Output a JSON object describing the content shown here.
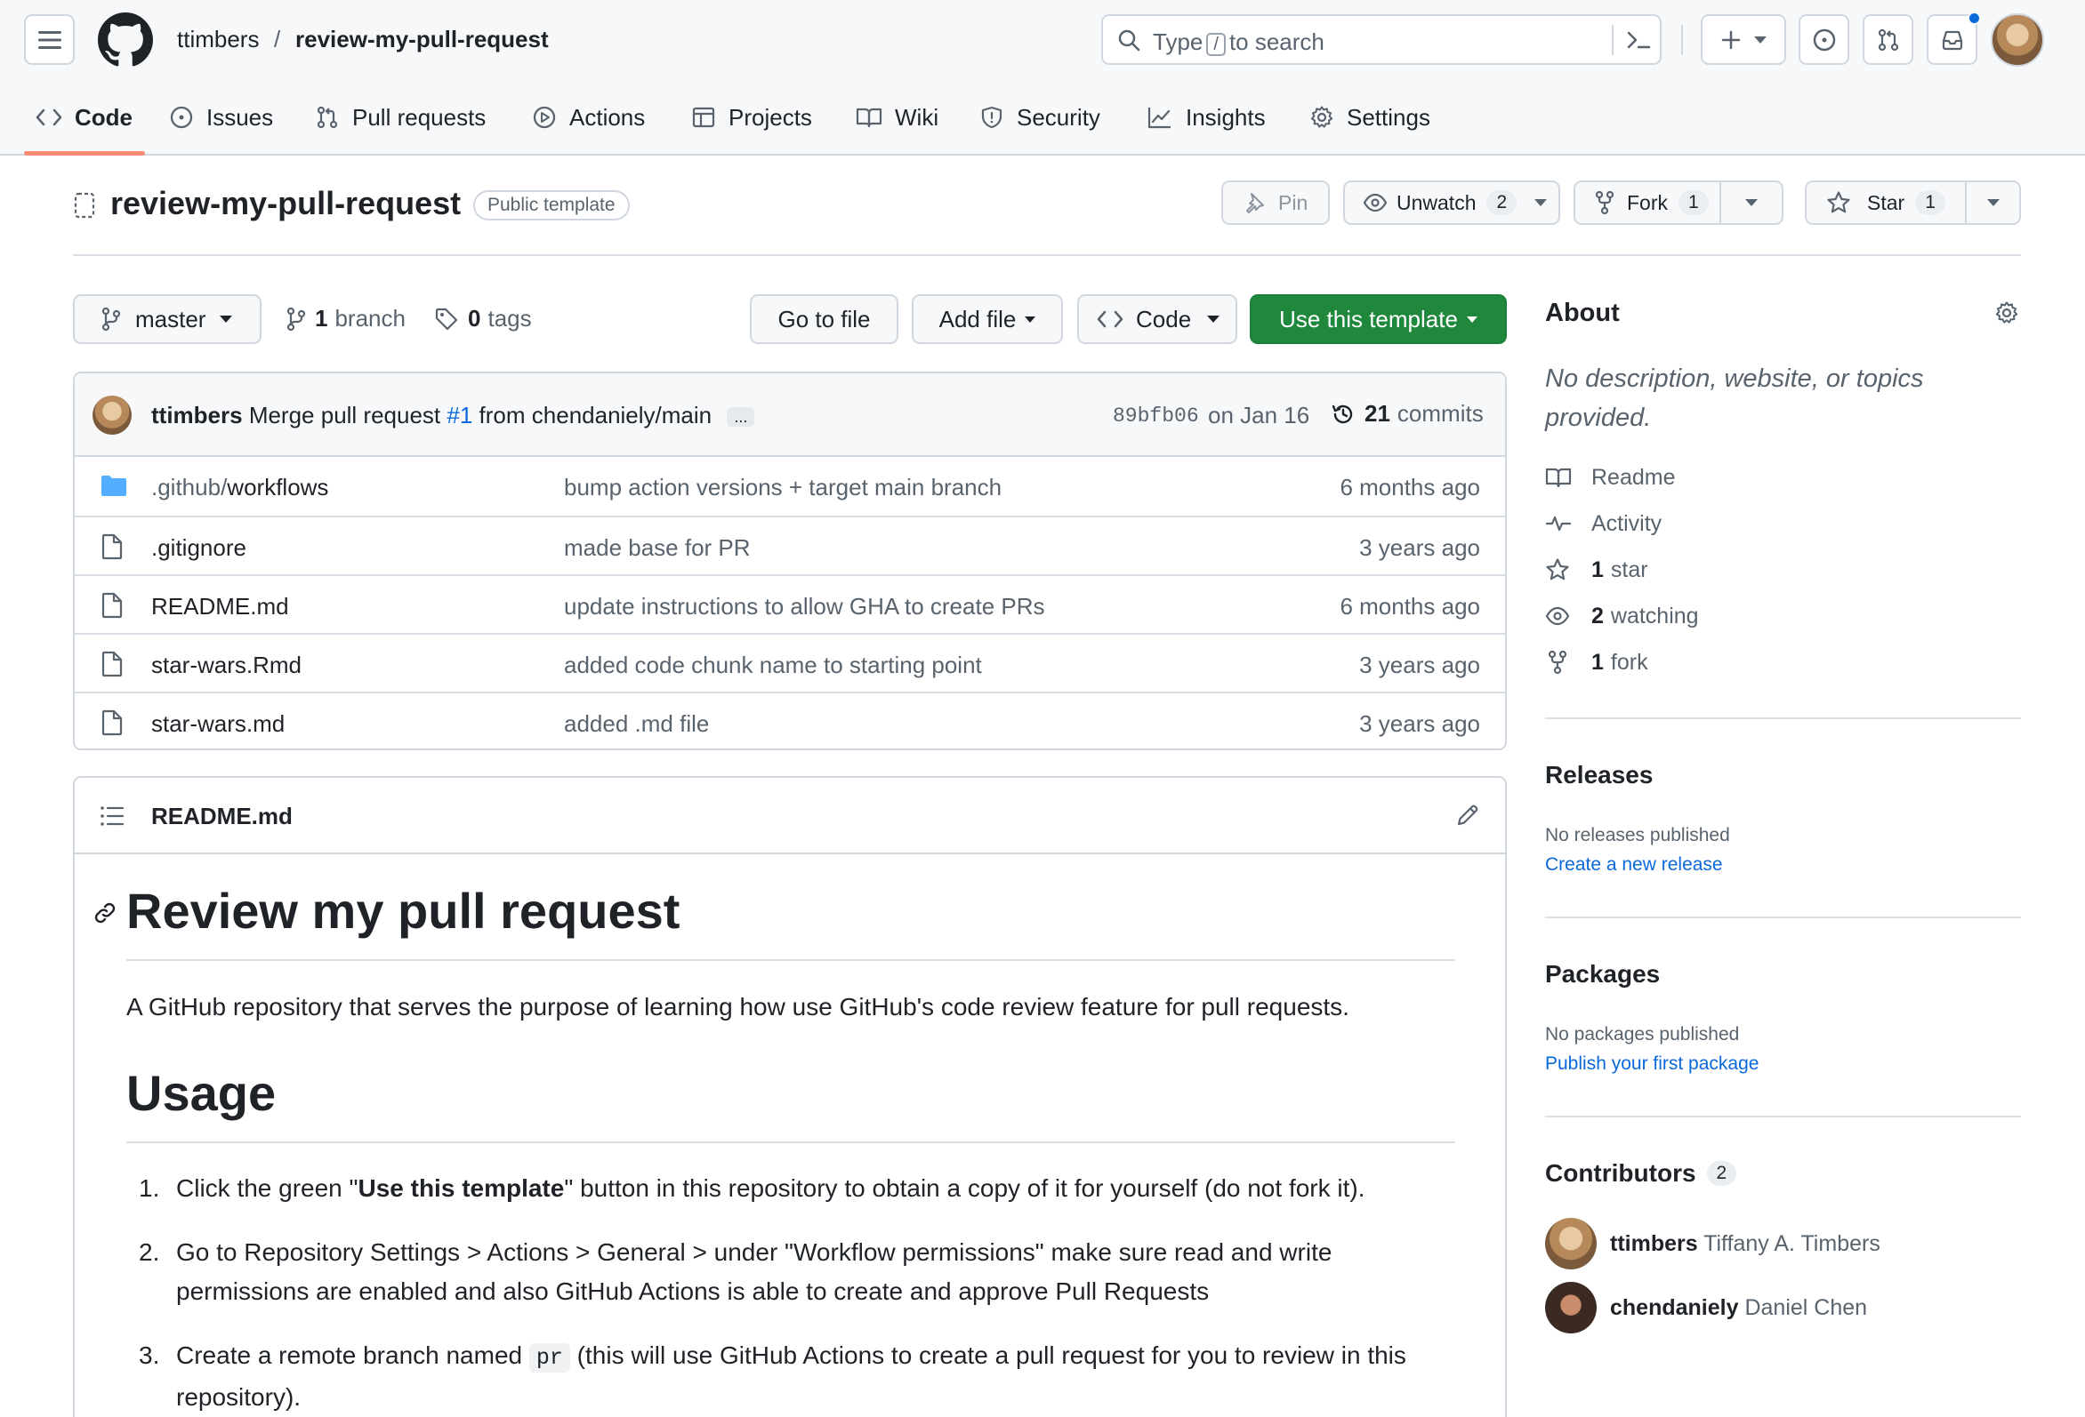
{
  "header": {
    "owner": "ttimbers",
    "separator": "/",
    "repo": "review-my-pull-request",
    "search_before": "Type",
    "search_key": "/",
    "search_after": "to search"
  },
  "nav": {
    "code": "Code",
    "issues": "Issues",
    "pull_requests": "Pull requests",
    "actions": "Actions",
    "projects": "Projects",
    "wiki": "Wiki",
    "security": "Security",
    "insights": "Insights",
    "settings": "Settings"
  },
  "repo": {
    "name": "review-my-pull-request",
    "visibility": "Public template",
    "pin": "Pin",
    "unwatch": "Unwatch",
    "watch_count": "2",
    "fork": "Fork",
    "fork_count": "1",
    "star": "Star",
    "star_count": "1"
  },
  "branchbar": {
    "branch": "master",
    "branches_count": "1",
    "branches_label": "branch",
    "tags_count": "0",
    "tags_label": "tags",
    "go_to_file": "Go to file",
    "add_file": "Add file",
    "code": "Code",
    "use_template": "Use this template"
  },
  "commit": {
    "author": "ttimbers",
    "message_before": "Merge pull request",
    "pr_link": "#1",
    "message_after": "from chendaniely/main",
    "more": "...",
    "sha": "89bfb06",
    "date": "on Jan 16",
    "commits_count": "21",
    "commits_label": "commits"
  },
  "files": [
    {
      "name_prefix": ".github/",
      "name": "workflows",
      "message": "bump action versions + target main branch",
      "age": "6 months ago",
      "type": "folder"
    },
    {
      "name_prefix": "",
      "name": ".gitignore",
      "message": "made base for PR",
      "age": "3 years ago",
      "type": "file"
    },
    {
      "name_prefix": "",
      "name": "README.md",
      "message": "update instructions to allow GHA to create PRs",
      "age": "6 months ago",
      "type": "file"
    },
    {
      "name_prefix": "",
      "name": "star-wars.Rmd",
      "message": "added code chunk name to starting point",
      "age": "3 years ago",
      "type": "file"
    },
    {
      "name_prefix": "",
      "name": "star-wars.md",
      "message": "added .md file",
      "age": "3 years ago",
      "type": "file"
    }
  ],
  "readme": {
    "filename": "README.md",
    "title": "Review my pull request",
    "intro": "A GitHub repository that serves the purpose of learning how use GitHub's code review feature for pull requests.",
    "usage_heading": "Usage",
    "steps": [
      {
        "num": "1.",
        "before": "Click the green \"",
        "bold": "Use this template",
        "after": "\" button in this repository to obtain a copy of it for yourself (do not fork it)."
      },
      {
        "num": "2.",
        "text": "Go to Repository Settings > Actions > General > under \"Workflow permissions\" make sure read and write permissions are enabled and also GitHub Actions is able to create and approve Pull Requests"
      },
      {
        "num": "3.",
        "before": "Create a remote branch named ",
        "code": "pr",
        "after": " (this will use GitHub Actions to create a pull request for you to review in this repository)."
      }
    ]
  },
  "sidebar": {
    "about": "About",
    "description": "No description, website, or topics provided.",
    "readme": "Readme",
    "activity": "Activity",
    "stars_count": "1",
    "stars_label": "star",
    "watching_count": "2",
    "watching_label": "watching",
    "forks_count": "1",
    "forks_label": "fork",
    "releases": "Releases",
    "no_releases": "No releases published",
    "create_release": "Create a new release",
    "packages": "Packages",
    "no_packages": "No packages published",
    "publish_package": "Publish your first package",
    "contributors": "Contributors",
    "contributors_count": "2",
    "contributor_list": [
      {
        "login": "ttimbers",
        "name": "Tiffany A. Timbers"
      },
      {
        "login": "chendaniely",
        "name": "Daniel Chen"
      }
    ]
  },
  "colors": {
    "accent_green": "#1f883d",
    "link_blue": "#0969da",
    "tab_underline": "#fd8c73",
    "folder_blue": "#54aeff"
  }
}
